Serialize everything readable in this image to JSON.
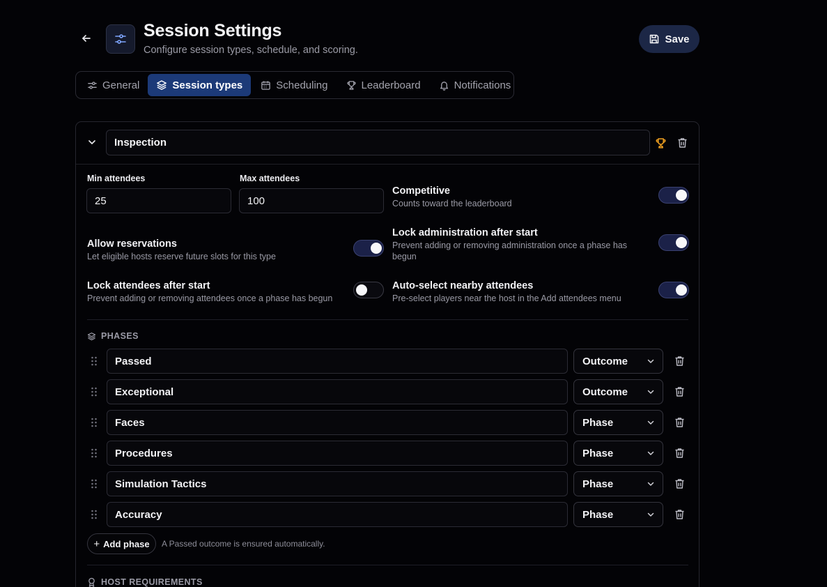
{
  "header": {
    "title": "Session Settings",
    "subtitle": "Configure session types, schedule, and scoring.",
    "save_label": "Save"
  },
  "tabs": [
    {
      "label": "General",
      "icon": "sliders-icon",
      "active": false
    },
    {
      "label": "Session types",
      "icon": "layers-icon",
      "active": true
    },
    {
      "label": "Scheduling",
      "icon": "calendar-icon",
      "active": false
    },
    {
      "label": "Leaderboard",
      "icon": "trophy-icon",
      "active": false
    },
    {
      "label": "Notifications",
      "icon": "bell-icon",
      "active": false
    }
  ],
  "session_type": {
    "name": "Inspection",
    "min_attendees_label": "Min attendees",
    "min_attendees": "25",
    "max_attendees_label": "Max attendees",
    "max_attendees": "100",
    "options": {
      "competitive": {
        "title": "Competitive",
        "desc": "Counts toward the leaderboard",
        "on": true
      },
      "allow_reservations": {
        "title": "Allow reservations",
        "desc": "Let eligible hosts reserve future slots for this type",
        "on": true
      },
      "lock_administration": {
        "title": "Lock administration after start",
        "desc": "Prevent adding or removing administration once a phase has begun",
        "on": true
      },
      "lock_attendees": {
        "title": "Lock attendees after start",
        "desc": "Prevent adding or removing attendees once a phase has begun",
        "on": false
      },
      "auto_select": {
        "title": "Auto-select nearby attendees",
        "desc": "Pre-select players near the host in the Add attendees menu",
        "on": true
      }
    },
    "phases_heading": "PHASES",
    "phases": [
      {
        "name": "Passed",
        "kind": "Outcome"
      },
      {
        "name": "Exceptional",
        "kind": "Outcome"
      },
      {
        "name": "Faces",
        "kind": "Phase"
      },
      {
        "name": "Procedures",
        "kind": "Phase"
      },
      {
        "name": "Simulation Tactics",
        "kind": "Phase"
      },
      {
        "name": "Accuracy",
        "kind": "Phase"
      }
    ],
    "add_phase_label": "Add phase",
    "add_phase_hint": "A Passed outcome is ensured automatically.",
    "host_requirements_heading": "HOST REQUIREMENTS"
  },
  "colors": {
    "background": "#030306",
    "accent": "#1c3a78",
    "save_button": "#1c2746",
    "trophy": "#f0a020",
    "toggle_on": "#1b2148"
  }
}
